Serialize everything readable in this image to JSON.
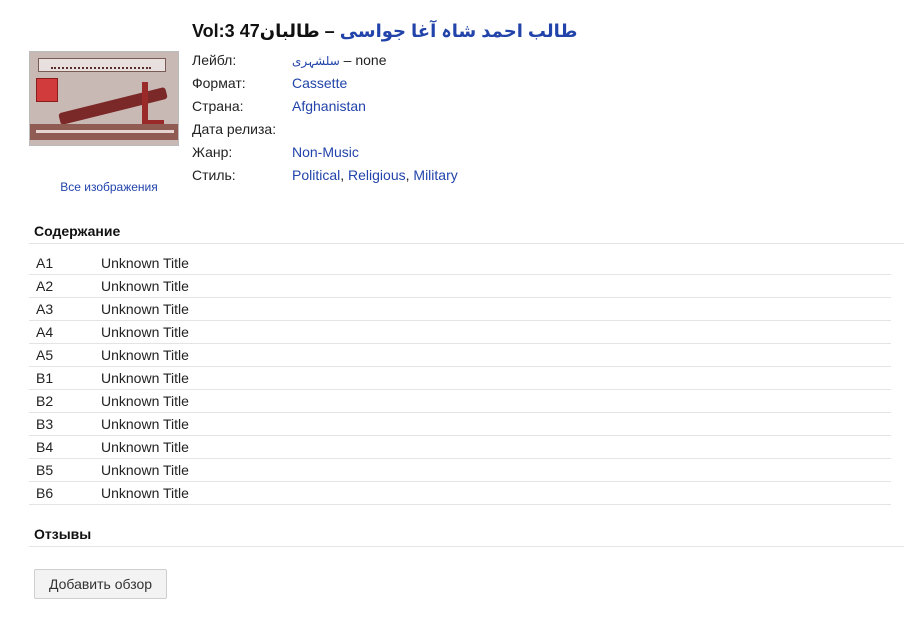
{
  "release": {
    "title": "طالبان47 Vol:3",
    "artist": "طالب احمد شاہ آغا جواسی",
    "separator": " – "
  },
  "cover": {
    "all_images_link": "Все изображения"
  },
  "info": {
    "label": {
      "key": "Лейбл:",
      "name": "سلشہری",
      "catalog": " – none"
    },
    "format": {
      "key": "Формат:",
      "value": "Cassette"
    },
    "country": {
      "key": "Страна:",
      "value": "Afghanistan"
    },
    "released": {
      "key": "Дата релиза:",
      "value": ""
    },
    "genre": {
      "key": "Жанр:",
      "value": "Non-Music"
    },
    "style": {
      "key": "Стиль:",
      "values": [
        "Political",
        "Religious",
        "Military"
      ],
      "sep": ", "
    }
  },
  "tracklist": {
    "heading": "Содержание",
    "tracks": [
      {
        "position": "A1",
        "title": "Unknown Title"
      },
      {
        "position": "A2",
        "title": "Unknown Title"
      },
      {
        "position": "A3",
        "title": "Unknown Title"
      },
      {
        "position": "A4",
        "title": "Unknown Title"
      },
      {
        "position": "A5",
        "title": "Unknown Title"
      },
      {
        "position": "B1",
        "title": "Unknown Title"
      },
      {
        "position": "B2",
        "title": "Unknown Title"
      },
      {
        "position": "B3",
        "title": "Unknown Title"
      },
      {
        "position": "B4",
        "title": "Unknown Title"
      },
      {
        "position": "B5",
        "title": "Unknown Title"
      },
      {
        "position": "B6",
        "title": "Unknown Title"
      }
    ]
  },
  "reviews": {
    "heading": "Отзывы",
    "add_button": "Добавить обзор"
  },
  "colors": {
    "link": "#2244aa",
    "text": "#222222",
    "divider": "#e4e4e4"
  }
}
